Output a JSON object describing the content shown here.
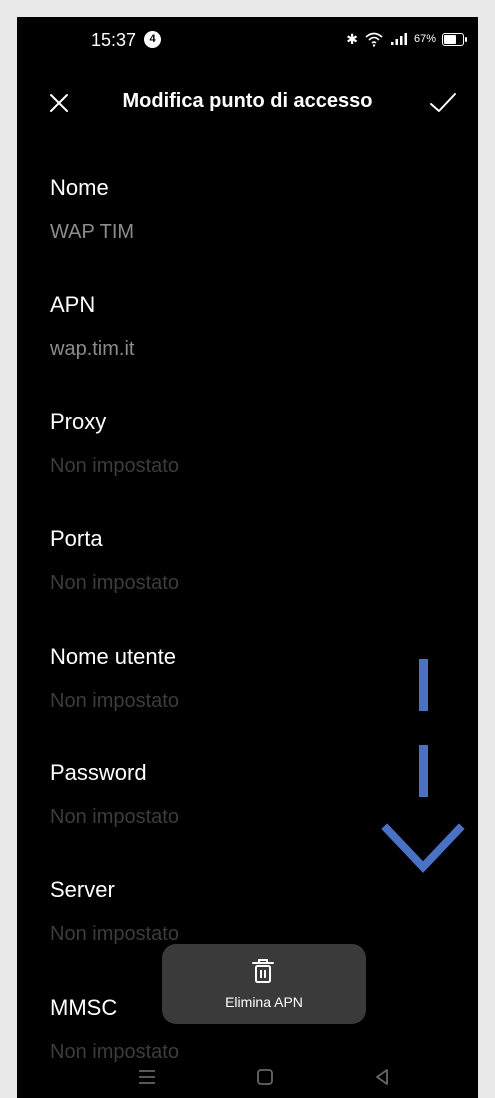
{
  "status_bar": {
    "time": "15:37",
    "notification_count": "4",
    "battery_text": "67%",
    "battery_level": 0.67
  },
  "header": {
    "title": "Modifica punto di accesso"
  },
  "fields": [
    {
      "label": "Nome",
      "value": "WAP TIM",
      "is_placeholder": false
    },
    {
      "label": "APN",
      "value": "wap.tim.it",
      "is_placeholder": false
    },
    {
      "label": "Proxy",
      "value": "Non impostato",
      "is_placeholder": true
    },
    {
      "label": "Porta",
      "value": "Non impostato",
      "is_placeholder": true
    },
    {
      "label": "Nome utente",
      "value": "Non impostato",
      "is_placeholder": true
    },
    {
      "label": "Password",
      "value": "Non impostato",
      "is_placeholder": true
    },
    {
      "label": "Server",
      "value": "Non impostato",
      "is_placeholder": true
    },
    {
      "label": "MMSC",
      "value": "Non impostato",
      "is_placeholder": true
    }
  ],
  "toast": {
    "label": "Elimina APN"
  },
  "colors": {
    "background": "#000000",
    "value_text": "#8c8c8c",
    "placeholder_text": "#3c3c3c",
    "arrow": "#4a72c4",
    "toast_bg": "#3a3a3a"
  },
  "icons": {
    "close": "close-icon",
    "confirm": "check-icon",
    "delete": "trash-icon",
    "scroll": "down-arrow-icon"
  }
}
